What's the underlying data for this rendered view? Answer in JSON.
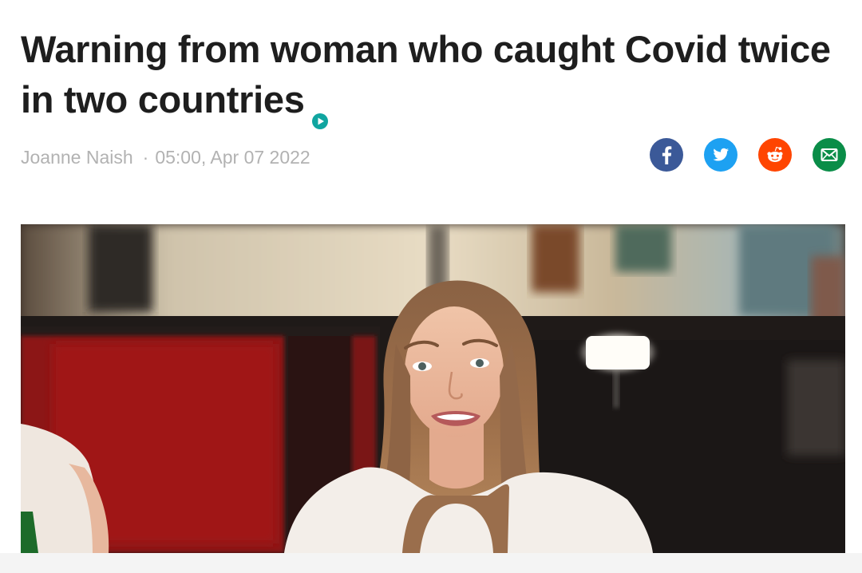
{
  "article": {
    "title": "Warning from woman who caught Covid twice in two countries",
    "author": "Joanne Naish",
    "separator": "·",
    "datetime": "05:00, Apr 07 2022"
  },
  "share": {
    "buttons": [
      {
        "icon": "facebook-icon",
        "color": "#3b5998"
      },
      {
        "icon": "twitter-icon",
        "color": "#1da1f2"
      },
      {
        "icon": "reddit-icon",
        "color": "#ff4500"
      },
      {
        "icon": "email-icon",
        "color": "#0a8d48"
      }
    ]
  },
  "colors": {
    "headline": "#1e1e1e",
    "byline": "#b2b2b2",
    "video_indicator": "#10a5a0"
  },
  "video": {
    "thumbnail_icon": "video-thumbnail"
  }
}
